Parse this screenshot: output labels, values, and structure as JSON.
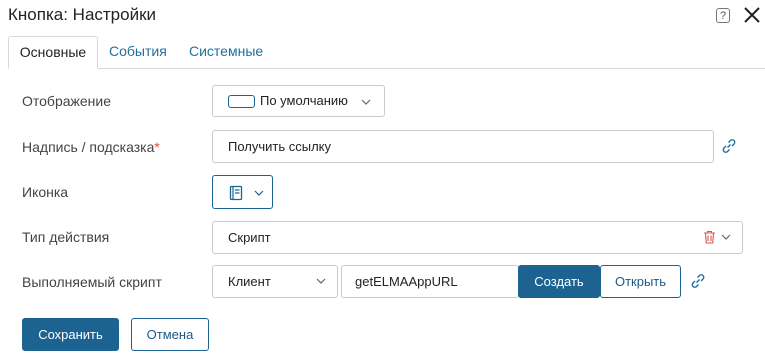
{
  "dialog": {
    "title": "Кнопка: Настройки",
    "help": "?"
  },
  "tabs": [
    {
      "label": "Основные",
      "active": true
    },
    {
      "label": "События",
      "active": false
    },
    {
      "label": "Системные",
      "active": false
    }
  ],
  "form": {
    "display": {
      "label": "Отображение",
      "value": "По умолчанию"
    },
    "caption": {
      "label": "Надпись / подсказка",
      "required_mark": "*",
      "value": "Получить ссылку"
    },
    "icon": {
      "label": "Иконка",
      "icon_name": "book-icon"
    },
    "action_type": {
      "label": "Тип действия",
      "value": "Скрипт"
    },
    "script": {
      "label": "Выполняемый скрипт",
      "side": "Клиент",
      "function_name": "getELMAAppURL",
      "create_label": "Создать",
      "open_label": "Открыть"
    }
  },
  "footer": {
    "save_label": "Сохранить",
    "cancel_label": "Отмена"
  },
  "colors": {
    "primary": "#1c6392",
    "link": "#1f6f9f",
    "delete": "#d9534f"
  }
}
